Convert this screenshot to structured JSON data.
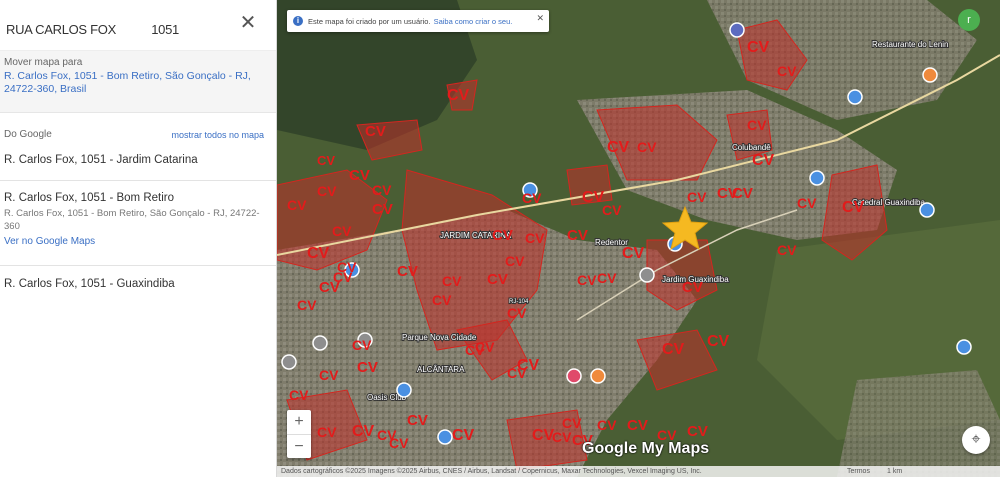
{
  "search": {
    "query": "RUA CARLOS FOX",
    "number": "1051"
  },
  "move_map": {
    "title": "Mover mapa para",
    "link": "R. Carlos Fox, 1051 - Bom Retiro, São Gonçalo - RJ, 24722-360, Brasil"
  },
  "google_section": {
    "label": "Do Google",
    "show_all": "mostrar todos no mapa"
  },
  "results": [
    {
      "title": "R. Carlos Fox, 1051 - Jardim Catarina"
    },
    {
      "title": "R. Carlos Fox, 1051 - Bom Retiro",
      "address": "R. Carlos Fox, 1051 - Bom Retiro, São Gonçalo - RJ, 24722-360",
      "link": "Ver no Google Maps"
    },
    {
      "title": "R. Carlos Fox, 1051 - Guaxindiba"
    }
  ],
  "notice": {
    "text": "Este mapa foi criado por um usuário.",
    "link": "Saiba como criar o seu."
  },
  "map_labels": {
    "cv": "CV",
    "places": [
      "JARDIM CATARINA",
      "ALCÂNTARA",
      "Restaurante do Lenin",
      "Redentor",
      "Jardim Guaxindiba",
      "Parque Nova Cidade",
      "Oasis Club",
      "Colubandê",
      "Catedral Guaxindiba"
    ],
    "road": "RJ-104"
  },
  "brand": "Google My Maps",
  "footer": {
    "attribution": "Dados cartográficos ©2025 Imagens ©2025 Airbus, CNES / Airbus, Landsat / Copernicus, Maxar Technologies, Vexcel Imaging US, Inc.",
    "terms": "Termos",
    "scale": "1 km"
  },
  "avatar_letter": "r",
  "colors": {
    "cv": "#e31b1b",
    "zone_fill": "#c0302a",
    "link": "#3a6fc4",
    "star": "#f5b921"
  }
}
